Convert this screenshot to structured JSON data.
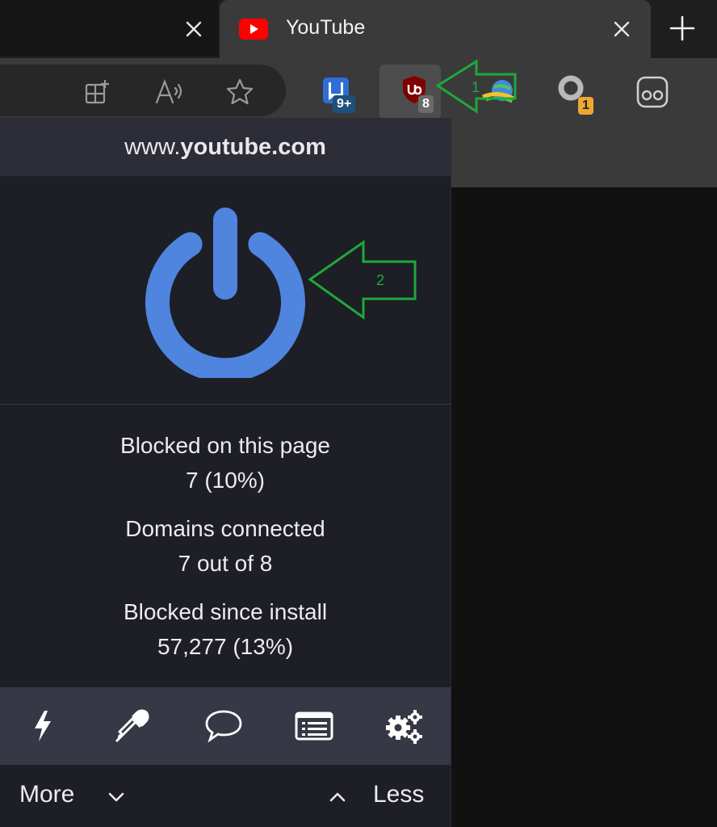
{
  "tabs": {
    "active_title": "YouTube",
    "active_favicon": "youtube-icon",
    "new_tab_icon": "plus-icon",
    "close_icon": "close-icon"
  },
  "toolbar": {
    "address_icons": [
      "add-tab-grid-icon",
      "read-aloud-icon",
      "favorite-star-icon"
    ],
    "extensions": [
      {
        "name": "bookmark-extension-icon",
        "badge": "9+",
        "badge_color": "#1f4f7a"
      },
      {
        "name": "ublock-origin-icon",
        "badge": "8",
        "badge_color": "#6b6b6b",
        "active": true
      },
      {
        "name": "download-manager-icon",
        "badge": ""
      },
      {
        "name": "ring-extension-icon",
        "badge": "1",
        "badge_color": "#f0a732"
      },
      {
        "name": "glasses-extension-icon",
        "badge": ""
      }
    ]
  },
  "popup": {
    "hostname_prefix": "www.",
    "hostname_domain": "youtube.com",
    "power_color": "#4f84df",
    "stats": [
      {
        "label": "Blocked on this page",
        "value": "7 (10%)"
      },
      {
        "label": "Domains connected",
        "value": "7 out of 8"
      },
      {
        "label": "Blocked since install",
        "value": "57,277 (13%)"
      }
    ],
    "tools": [
      "lightning-icon",
      "eyedropper-icon",
      "speech-bubble-icon",
      "logger-list-icon",
      "settings-gears-icon"
    ],
    "more_label": "More",
    "less_label": "Less"
  },
  "annotations": {
    "arrow_1_label": "1",
    "arrow_2_label": "2",
    "arrow_color": "#1fa83a"
  }
}
